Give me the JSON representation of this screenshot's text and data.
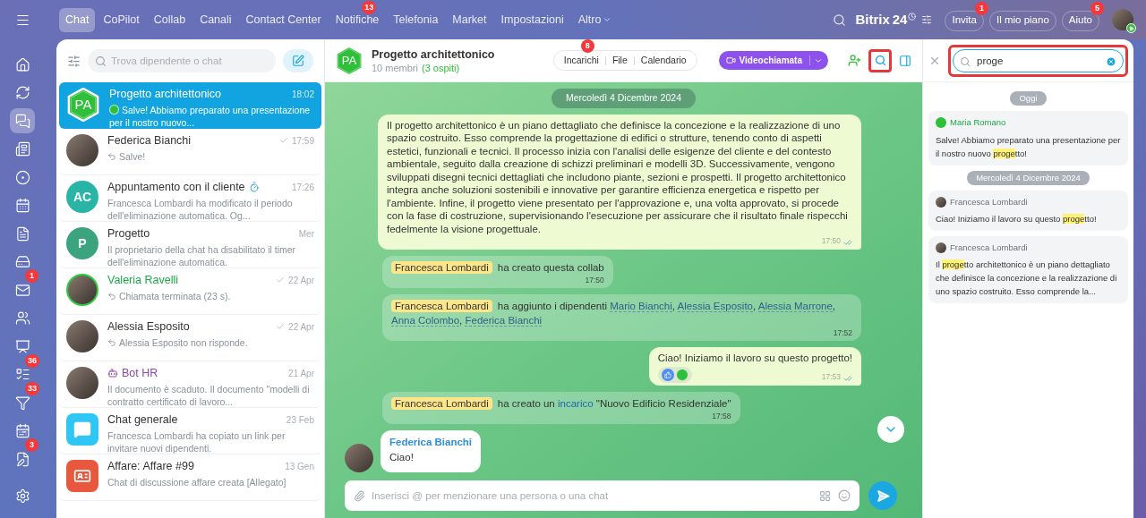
{
  "rail": {
    "items": [
      {
        "selected": false
      },
      {
        "selected": false
      },
      {
        "selected": true
      },
      {
        "selected": false
      },
      {
        "selected": false
      },
      {
        "selected": false
      },
      {
        "selected": false
      },
      {
        "selected": false
      },
      {
        "selected": false,
        "badge": "1"
      },
      {
        "selected": false
      },
      {
        "selected": false
      },
      {
        "selected": false,
        "badge": "36"
      },
      {
        "selected": false,
        "badge": "33"
      },
      {
        "selected": false
      },
      {
        "selected": false,
        "badge": "3"
      }
    ]
  },
  "top_nav": {
    "tabs": [
      {
        "label": "Chat",
        "selected": true,
        "dropdown": false
      },
      {
        "label": "CoPilot",
        "selected": false,
        "dropdown": false
      },
      {
        "label": "Collab",
        "selected": false,
        "dropdown": false
      },
      {
        "label": "Canali",
        "selected": false,
        "dropdown": false
      },
      {
        "label": "Contact Center",
        "selected": false,
        "dropdown": false
      },
      {
        "label": "Notifiche",
        "selected": false,
        "dropdown": false,
        "badge": "13"
      },
      {
        "label": "Telefonia",
        "selected": false,
        "dropdown": false
      },
      {
        "label": "Market",
        "selected": false,
        "dropdown": false
      },
      {
        "label": "Impostazioni",
        "selected": false,
        "dropdown": false
      },
      {
        "label": "Altro",
        "selected": false,
        "dropdown": true
      }
    ],
    "logo": {
      "name": "Bitrix",
      "number": "24"
    },
    "buttons": [
      {
        "label": "Invita",
        "badge": "1"
      },
      {
        "label": "Il mio piano"
      },
      {
        "label": "Aiuto",
        "badge": "5"
      }
    ]
  },
  "chat_list": {
    "search": {
      "placeholder": "Trova dipendente o chat"
    },
    "items": [
      {
        "kind": "user",
        "title": "Progetto architettonico",
        "time": "18:02",
        "preview": "Salve! Abbiamo preparato una presentazione per il nostro nuovo...",
        "avatar": {
          "kind": "hex",
          "text": "PA"
        },
        "selected": true,
        "read": false,
        "outgoing": false,
        "timer": false,
        "sender_avatar": true
      },
      {
        "kind": "user",
        "title": "Federica Bianchi",
        "time": "17:59",
        "preview": "Salve!",
        "avatar": {
          "kind": "photo"
        },
        "selected": false,
        "read": true,
        "outgoing": true,
        "timer": false,
        "sender_avatar": false
      },
      {
        "kind": "user",
        "title": "Appuntamento con il cliente",
        "time": "17:26",
        "preview": "Francesca Lombardi ha modificato il periodo dell'eliminazione automatica. Og...",
        "avatar": {
          "kind": "initials",
          "text": "AC",
          "color": "#28b5a6"
        },
        "selected": false,
        "read": false,
        "outgoing": false,
        "timer": true,
        "sender_avatar": false
      },
      {
        "kind": "user",
        "title": "Progetto",
        "time": "Mer",
        "preview": "Il proprietario della chat ha disabilitato il timer dell'eliminazione automatica.",
        "avatar": {
          "kind": "initials",
          "text": "P",
          "color": "#3ba47e"
        },
        "selected": false,
        "read": false,
        "outgoing": false,
        "timer": false,
        "sender_avatar": false
      },
      {
        "kind": "guest",
        "title": "Valeria Ravelli",
        "time": "22 Apr",
        "preview": "Chiamata terminata (23 s).",
        "avatar": {
          "kind": "photo"
        },
        "selected": false,
        "read": true,
        "outgoing": true,
        "timer": false,
        "sender_avatar": false
      },
      {
        "kind": "user",
        "title": "Alessia Esposito",
        "time": "22 Apr",
        "preview": "Alessia Esposito non risponde.",
        "avatar": {
          "kind": "photo"
        },
        "selected": false,
        "read": true,
        "outgoing": true,
        "timer": false,
        "sender_avatar": false
      },
      {
        "kind": "bot",
        "title": "Bot HR",
        "time": "21 Apr",
        "preview": "Il documento è scaduto. Il documento \"modelli di contratto certificato di lavoro...",
        "avatar": {
          "kind": "photo"
        },
        "selected": false,
        "read": false,
        "outgoing": false,
        "timer": false,
        "sender_avatar": false
      },
      {
        "kind": "user",
        "title": "Chat generale",
        "time": "23 Feb",
        "preview": "Francesca Lombardi ha copiato un link per invitare nuovi dipendenti.",
        "avatar": {
          "kind": "chat_icon",
          "color": "#2fc6f6"
        },
        "selected": false,
        "read": false,
        "outgoing": false,
        "timer": false,
        "sender_avatar": false
      },
      {
        "kind": "user",
        "title": "Affare: Affare #99",
        "time": "13 Gen",
        "preview": "Chat di discussione affare creata [Allegato]",
        "avatar": {
          "kind": "deal_icon",
          "color": "#e9573f"
        },
        "selected": false,
        "read": false,
        "outgoing": false,
        "timer": false,
        "sender_avatar": false
      }
    ]
  },
  "chat": {
    "header": {
      "avatar": "PA",
      "title": "Progetto architettonico",
      "members": "10 membri",
      "guests": "(3 ospiti)",
      "tabs": [
        {
          "label": "Incarichi",
          "badge": "8"
        },
        {
          "label": "File"
        },
        {
          "label": "Calendario"
        }
      ],
      "call_button": "Videochiamata",
      "search_annotated": true
    },
    "messages": [
      {
        "kind": "date",
        "text": "Mercoledì 4 Dicembre 2024"
      },
      {
        "kind": "own",
        "text": "Il progetto architettonico è un piano dettagliato che definisce la concezione e la realizzazione di uno spazio costruito. Esso comprende la progettazione di edifici o strutture, tenendo conto di aspetti estetici, funzionali e tecnici. Il processo inizia con l'analisi delle esigenze del cliente e del contesto ambientale, seguito dalla creazione di schizzi preliminari e modelli 3D. Successivamente, vengono sviluppati disegni tecnici dettagliati che includono piante, sezioni e prospetti. Il progetto architettonico integra anche soluzioni sostenibili e innovative per garantire efficienza energetica e rispetto per l'ambiente. Infine, il progetto viene presentato per l'approvazione e, una volta approvato, si procede con la fase di costruzione, supervisionando l'esecuzione per assicurare che il risultato finale rispecchi fedelmente la visione progettuale.",
        "time": "17:50",
        "read": true
      },
      {
        "kind": "system",
        "time": "17:50",
        "segments": [
          {
            "kind": "mention",
            "text": "Francesca Lombardi"
          },
          {
            "kind": "text",
            "text": "ha creato questa collab"
          }
        ]
      },
      {
        "kind": "system",
        "time": "17:52",
        "segments": [
          {
            "kind": "mention",
            "text": "Francesca Lombardi"
          },
          {
            "kind": "text",
            "text": "ha aggiunto i dipendenti "
          },
          {
            "kind": "user_link",
            "text": "Mario Bianchi"
          },
          {
            "kind": "text",
            "text": ", "
          },
          {
            "kind": "user_link",
            "text": "Alessia Esposito"
          },
          {
            "kind": "text",
            "text": ", "
          },
          {
            "kind": "user_link",
            "text": "Alessia Marrone"
          },
          {
            "kind": "text",
            "text": ", "
          },
          {
            "kind": "user_link",
            "text": "Anna Colombo"
          },
          {
            "kind": "text",
            "text": ", "
          },
          {
            "kind": "user_link",
            "text": "Federica Bianchi"
          }
        ]
      },
      {
        "kind": "own",
        "text": "Ciao! Iniziamo il lavoro su questo progetto!",
        "time": "17:53",
        "read": true,
        "reactions": [
          {
            "kind": "like"
          },
          {
            "kind": "avatar"
          }
        ]
      },
      {
        "kind": "system",
        "time": "17:58",
        "segments": [
          {
            "kind": "mention",
            "text": "Francesca Lombardi"
          },
          {
            "kind": "text",
            "text": "ha creato un "
          },
          {
            "kind": "link",
            "text": "incarico"
          },
          {
            "kind": "text",
            "text": " \"Nuovo Edificio Residenziale\""
          }
        ]
      },
      {
        "kind": "incoming",
        "author": "Federica Bianchi",
        "text": "Ciao!"
      }
    ],
    "input": {
      "placeholder": "Inserisci @ per menzionare una persona o una chat"
    }
  },
  "search_panel": {
    "query": "proge",
    "annotated": true,
    "results": [
      {
        "kind": "date",
        "text": "Oggi"
      },
      {
        "kind": "result",
        "author": "Maria Romano",
        "avatar": {
          "kind": "initials"
        },
        "guest": true,
        "segments": [
          {
            "text": "Salve! Abbiamo preparato una presentazione per il nostro nuovo ",
            "highlight": false
          },
          {
            "text": "proge",
            "highlight": true
          },
          {
            "text": "tto!",
            "highlight": false
          }
        ]
      },
      {
        "kind": "date",
        "text": "Mercoledì 4 Dicembre 2024"
      },
      {
        "kind": "result",
        "author": "Francesca Lombardi",
        "avatar": {
          "kind": "photo"
        },
        "guest": false,
        "segments": [
          {
            "text": "Ciao! Iniziamo il lavoro su questo ",
            "highlight": false
          },
          {
            "text": "proge",
            "highlight": true
          },
          {
            "text": "tto!",
            "highlight": false
          }
        ]
      },
      {
        "kind": "result",
        "author": "Francesca Lombardi",
        "avatar": {
          "kind": "photo"
        },
        "guest": false,
        "segments": [
          {
            "text": "Il ",
            "highlight": false
          },
          {
            "text": "proge",
            "highlight": true
          },
          {
            "text": "tto architettonico è un piano dettagliato che definisce la concezione e la realizzazione di uno spazio costruito. Esso comprende la...",
            "highlight": false
          }
        ]
      }
    ]
  }
}
